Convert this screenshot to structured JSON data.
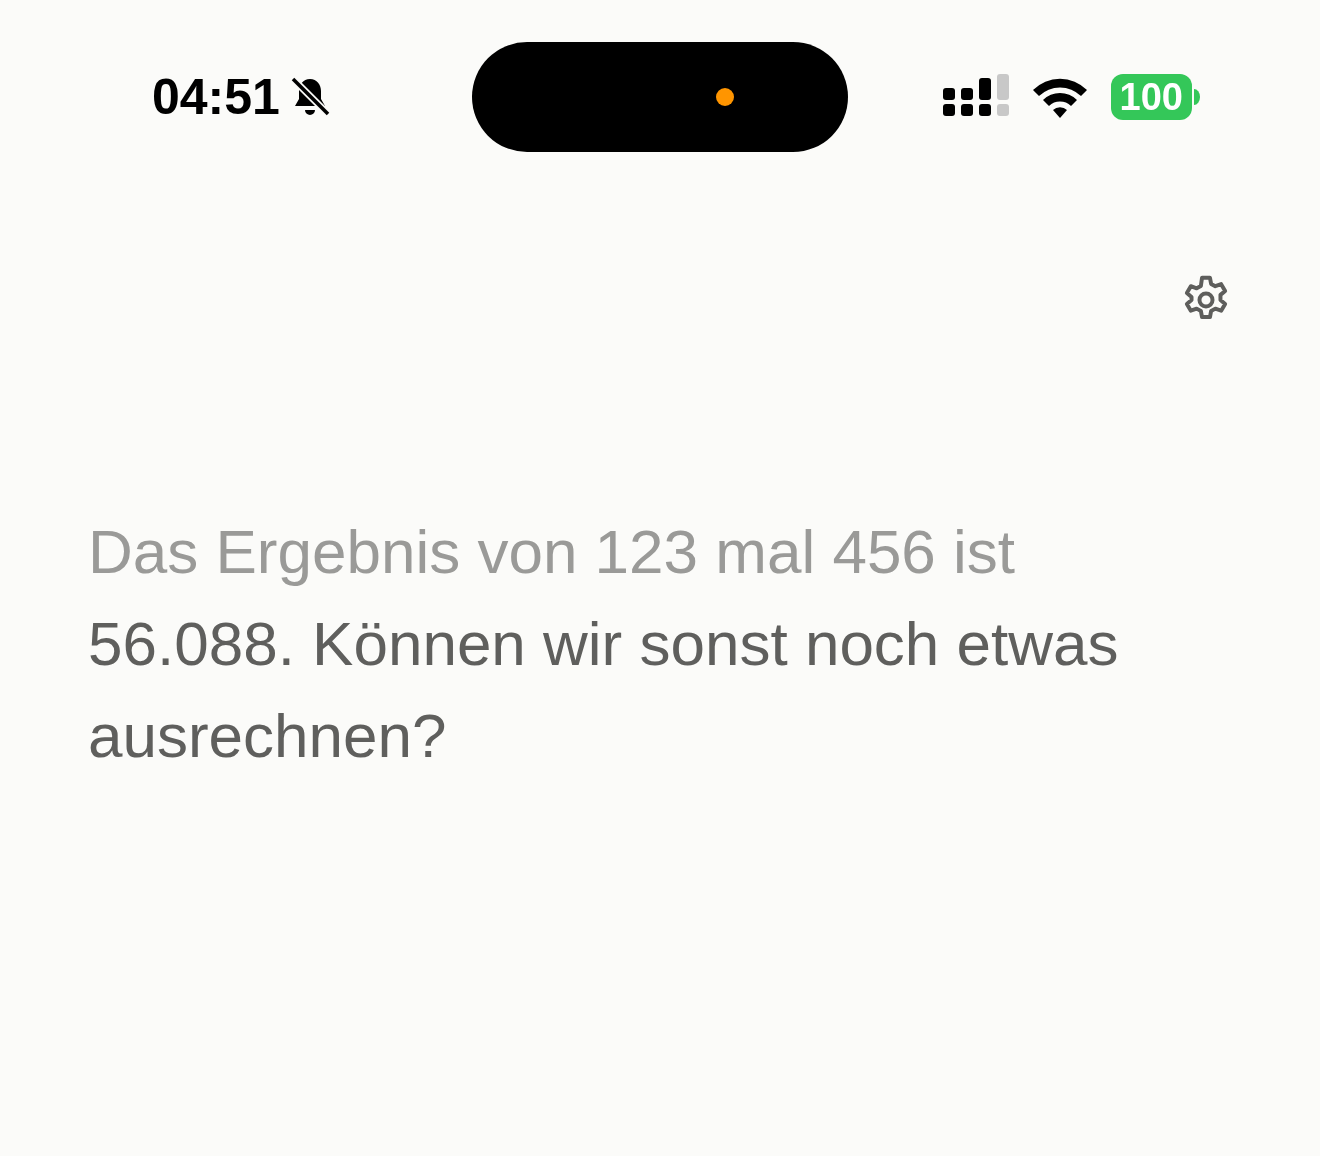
{
  "status_bar": {
    "time": "04:51",
    "silent": true,
    "battery": "100"
  },
  "message": {
    "segments": [
      {
        "text": "Das Ergebnis von 123 mal 456 ist ",
        "dimmed": true
      },
      {
        "text": "56.088. Können wir sonst noch etwas ausrechnen?",
        "dimmed": false
      }
    ]
  }
}
